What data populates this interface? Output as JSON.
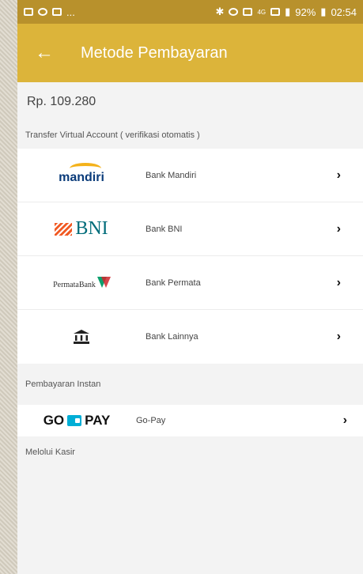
{
  "status_bar": {
    "left_text": "...",
    "signal_text": "4G",
    "battery": "92%",
    "time": "02:54"
  },
  "appbar": {
    "back_icon": "←",
    "title": "Metode Pembayaran"
  },
  "amount": "Rp. 109.280",
  "sections": {
    "va_title": "Transfer Virtual Account ( verifikasi otomatis )",
    "instant_title": "Pembayaran Instan",
    "kasir_title": "Melolui Kasir"
  },
  "banks": [
    {
      "logo_text": "mandiri",
      "name": "Bank Mandiri"
    },
    {
      "logo_text": "BNI",
      "name": "Bank BNI"
    },
    {
      "logo_text": "PermataBank",
      "name": "Bank Permata"
    },
    {
      "logo_text": "",
      "name": "Bank Lainnya"
    }
  ],
  "instant": [
    {
      "logo_text_left": "GO",
      "logo_text_right": "PAY",
      "name": "Go-Pay"
    }
  ],
  "chevron": "›",
  "colors": {
    "status_bar": "#b8912c",
    "appbar": "#dcb43a",
    "background": "#f3f3f3"
  }
}
